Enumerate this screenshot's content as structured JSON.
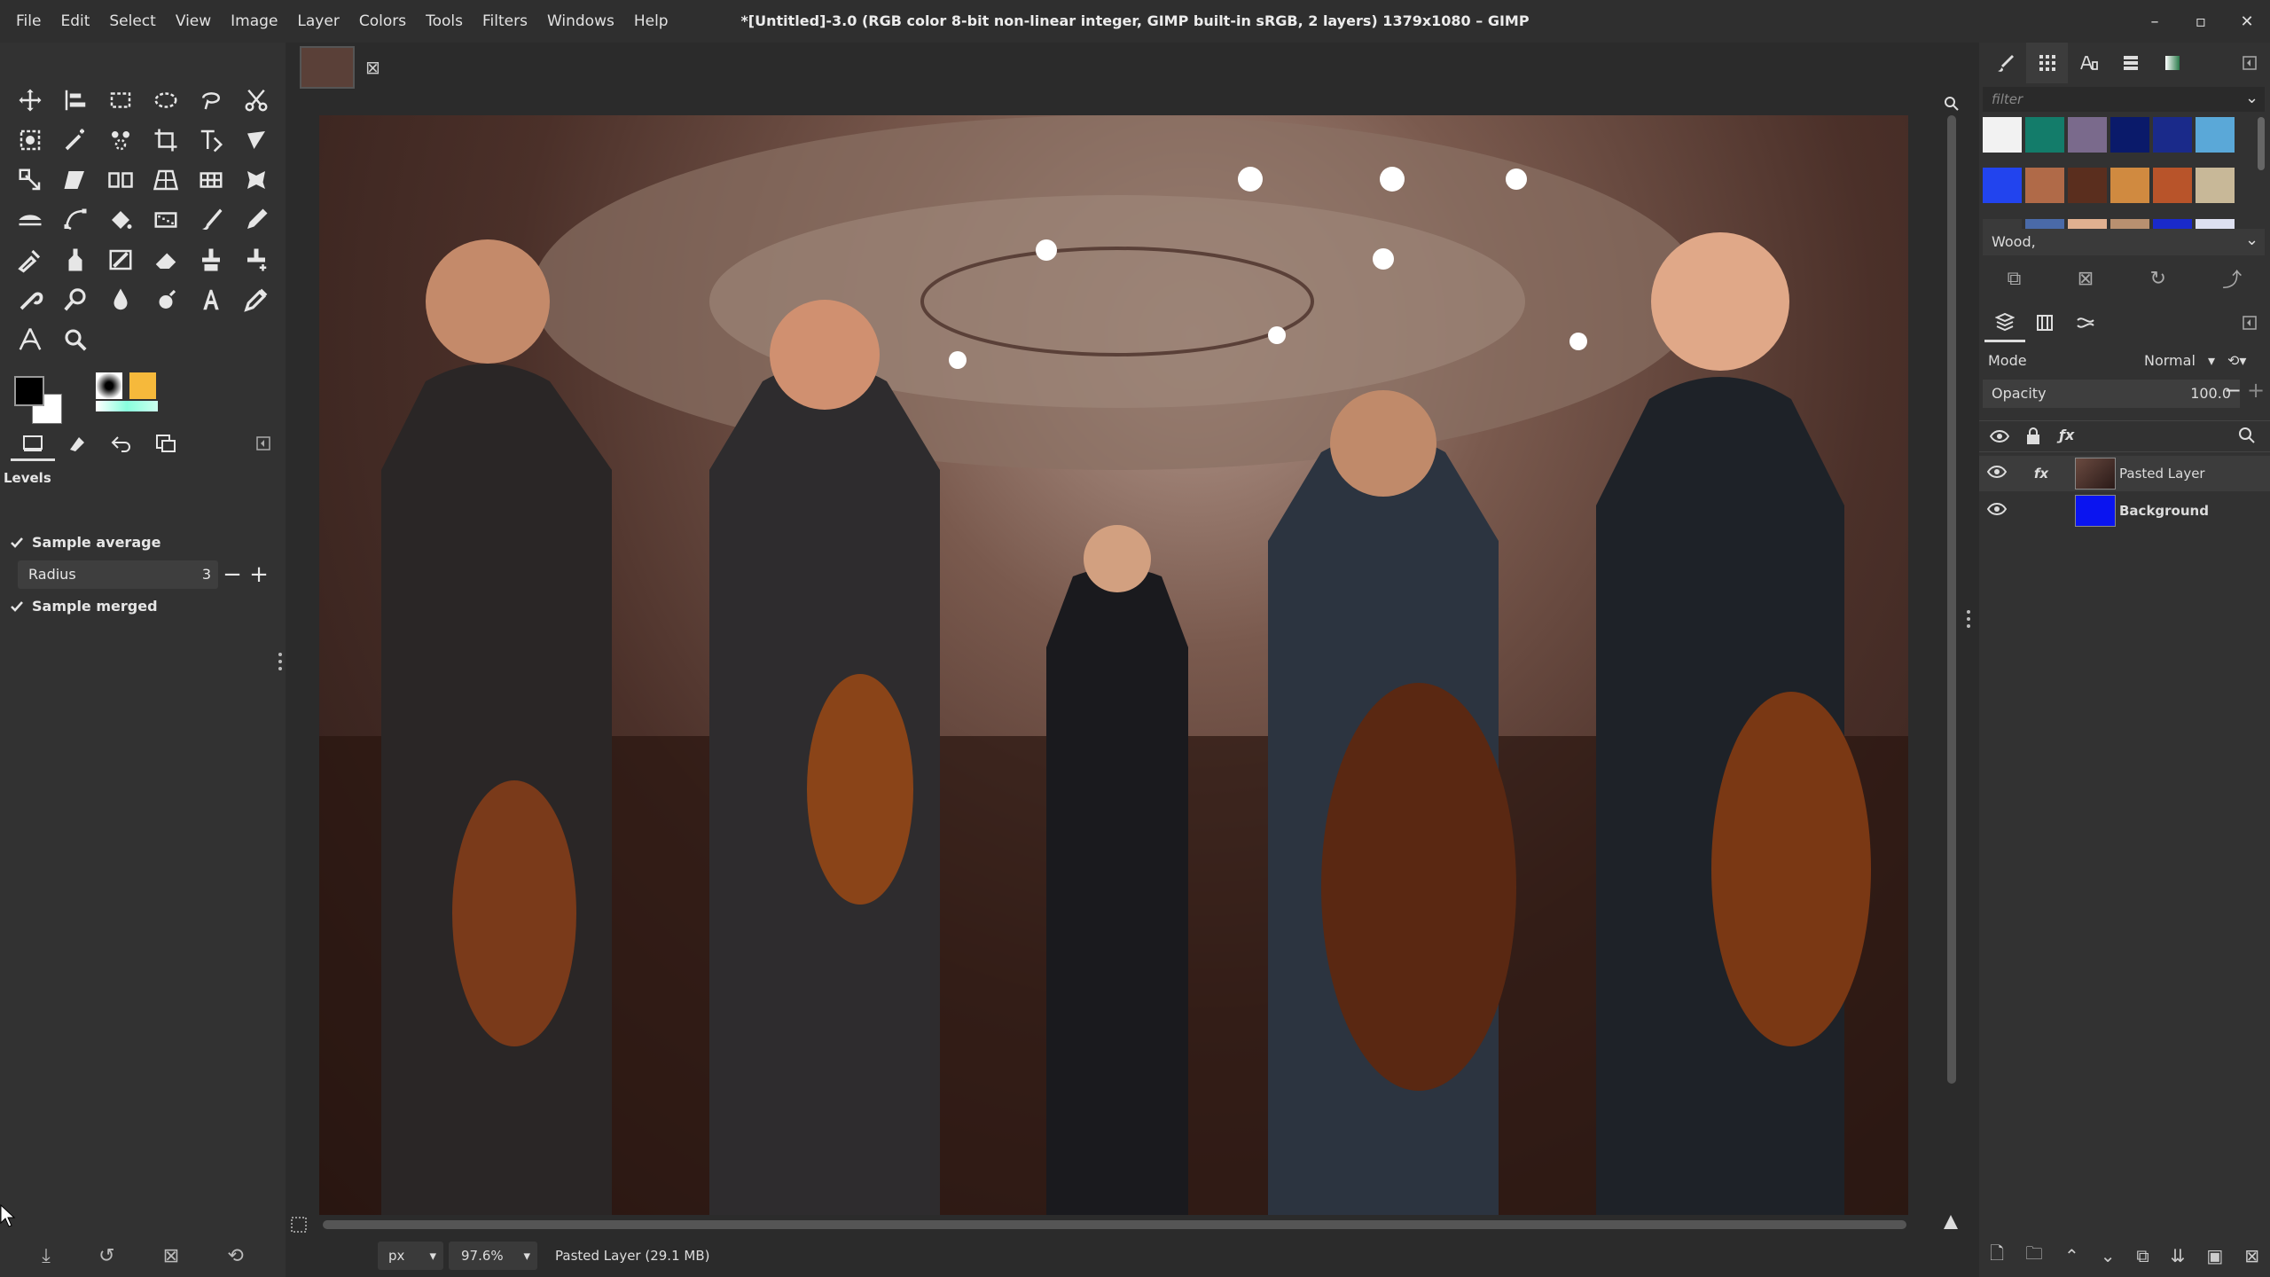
{
  "menubar": {
    "items": [
      "File",
      "Edit",
      "Select",
      "View",
      "Image",
      "Layer",
      "Colors",
      "Tools",
      "Filters",
      "Windows",
      "Help"
    ],
    "title": "*[Untitled]-3.0 (RGB color 8-bit non-linear integer, GIMP built-in sRGB, 2 layers) 1379x1080 – GIMP",
    "controls": [
      "–",
      "▫",
      "✕"
    ]
  },
  "toolbox": {
    "tools": [
      "move",
      "align",
      "rect-select",
      "ellipse-select",
      "free-select",
      "scissors",
      "foreground-select",
      "fuzzy-select",
      "by-color-select",
      "crop",
      "unified-transform",
      "warp",
      "scale",
      "shear",
      "handle",
      "perspective",
      "3d-transform",
      "cage",
      "flip",
      "path",
      "bucket-fill",
      "gradient",
      "paintbrush",
      "pencil",
      "airbrush",
      "ink",
      "mypaint",
      "eraser",
      "clone",
      "heal",
      "smudge",
      "dodge",
      "blur",
      "convolve",
      "text",
      "color-picker",
      "measure",
      "zoom"
    ],
    "fg_color": "#000000",
    "bg_color": "#ffffff",
    "pattern_color": "#f6b93b"
  },
  "tool_options": {
    "title": "Levels",
    "sample_average": "Sample average",
    "radius_label": "Radius",
    "radius_value": "3",
    "sample_merged": "Sample merged"
  },
  "canvas": {
    "image_tab_close": "⊠"
  },
  "status": {
    "unit": "px",
    "zoom": "97.6%",
    "message": "Pasted Layer (29.1 MB)"
  },
  "patterns_panel": {
    "filter_placeholder": "filter",
    "selected_pattern": "Wood,",
    "swatches": [
      "#f2f2f2",
      "#137c6a",
      "#7a6a8c",
      "#0a1a6a",
      "#1a2a8a",
      "#5aa8d8",
      "#2244ee",
      "#b06a48",
      "#5a2e1e",
      "#d08a40",
      "#b8542a",
      "#c8b898",
      "#3a3a3a",
      "#4a6aa8",
      "#e0b090",
      "#b89070",
      "#1a2aca",
      "#dde0f0"
    ]
  },
  "layers_panel": {
    "mode_label": "Mode",
    "mode_value": "Normal",
    "opacity_label": "Opacity",
    "opacity_value": "100.0",
    "layers": [
      {
        "name": "Pasted Layer",
        "fx": "fx",
        "visible": true
      },
      {
        "name": "Background",
        "fx": "",
        "visible": true
      }
    ]
  }
}
